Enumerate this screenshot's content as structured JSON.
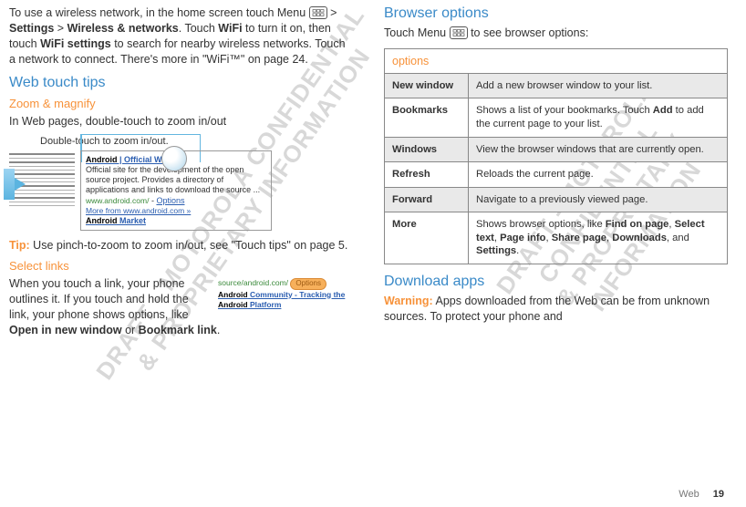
{
  "watermark": {
    "line1": "DRAFT - MOTOROLA CONFIDENTIAL",
    "line2": "& PROPRIETARY INFORMATION"
  },
  "left": {
    "intro_p1a": "To use a wireless network, in the home screen touch Menu ",
    "intro_p1b": " > ",
    "intro_p1c": "Settings",
    "intro_p1d": " > ",
    "intro_p1e": "Wireless & networks",
    "intro_p1f": ". Touch ",
    "intro_p1g": "WiFi",
    "intro_p1h": " to turn it on, then touch ",
    "intro_p1i": "WiFi settings",
    "intro_p1j": " to search for nearby wireless networks. Touch a network to connect. There's more in \"WiFi™\" on page 24.",
    "h_webtips": "Web touch tips",
    "h_zoom": "Zoom & magnify",
    "zoom_text": "In Web pages, double-touch to zoom in/out",
    "annot": "Double-touch to zoom in/out.",
    "sr": {
      "title_a": "Android",
      "title_b": " | Official Website",
      "body": "Official site for the development of the open source project. Provides a directory of applications and links to download the source ...",
      "url": "www.android.com/",
      "opt": "Options",
      "more": "More from www.android.com »",
      "market_a": "Android",
      "market_b": " Market"
    },
    "tip_label": "Tip:",
    "tip_text": " Use pinch-to-zoom to zoom in/out, see \"Touch tips\" on page 5.",
    "h_select": "Select links",
    "mini": {
      "url": "source/android.com/",
      "opt": "Options",
      "line2a": "Android",
      "line2b": " Community - Tracking the ",
      "line2c": "Android",
      "line2d": " Platform"
    },
    "select_a": "When you touch a link, your phone outlines it. If you touch and hold the link, your phone shows options, like ",
    "select_b": "Open in new window",
    "select_c": " or ",
    "select_d": "Bookmark link",
    "select_e": "."
  },
  "right": {
    "h_browser": "Browser options",
    "menu_a": "Touch Menu ",
    "menu_b": " to see browser options:",
    "options_header": "options",
    "rows": [
      {
        "h": "New window",
        "d": "Add a new browser window to your list.",
        "g": true
      },
      {
        "h": "Bookmarks",
        "d_a": "Shows a list of your bookmarks. Touch ",
        "d_b": "Add",
        "d_c": " to add the current page to your list.",
        "g": false
      },
      {
        "h": "Windows",
        "d": "View the browser windows that are currently open.",
        "g": true
      },
      {
        "h": "Refresh",
        "d": "Reloads the current page.",
        "g": false
      },
      {
        "h": "Forward",
        "d": "Navigate to a previously viewed page.",
        "g": true
      },
      {
        "h": "More",
        "d_a": "Shows browser options, like ",
        "d_parts": [
          "Find on page",
          "Select text",
          "Page info",
          "Share page",
          "Downloads"
        ],
        "d_last": "Settings",
        "g": false
      }
    ],
    "h_download": "Download apps",
    "warn_label": "Warning:",
    "warn_text": " Apps downloaded from the Web can be from unknown sources. To protect your phone and"
  },
  "footer": {
    "section": "Web",
    "page": "19"
  }
}
